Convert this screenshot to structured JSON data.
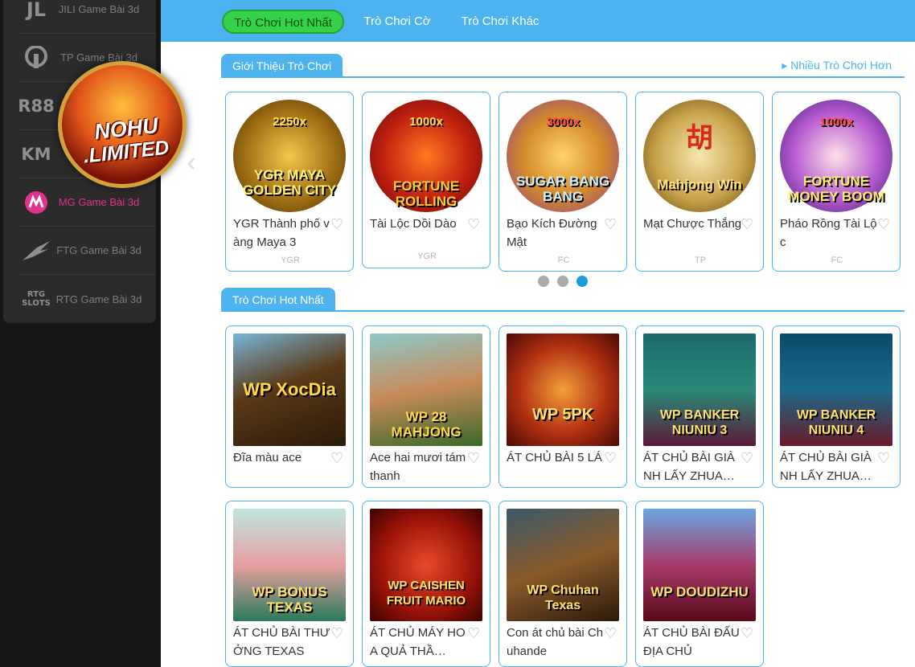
{
  "sidebar": {
    "providers": [
      {
        "logo": "JL",
        "label": "JILI Game Bài 3d"
      },
      {
        "logo": "TP",
        "label": "TP Game Bài 3d"
      },
      {
        "logo": "R88",
        "label": ""
      },
      {
        "logo": "KM",
        "label": ""
      },
      {
        "logo": "M",
        "label": "MG Game Bài 3d"
      },
      {
        "logo": "FTG",
        "label": "FTG Game Bài 3d"
      },
      {
        "logo": "RTG SLOTS",
        "label": "RTG Game Bài 3d"
      }
    ]
  },
  "badge": {
    "line1": "NOHU",
    "line2": ".LIMITED"
  },
  "carousel_prev": "‹",
  "tabs": [
    {
      "label": "Trò Chơi Hot Nhất",
      "active": true
    },
    {
      "label": "Trò Chơi Cờ",
      "active": false
    },
    {
      "label": "Trò Chơi Khác",
      "active": false
    }
  ],
  "featured": {
    "title": "Giới Thiệu Trò Chơi",
    "more": "▸ Nhiều Trò Chơi Hơn",
    "games": [
      {
        "art": "YGR MAYA GOLDEN CITY",
        "badge": "2250x",
        "title": "YGR Thành phố vàng Maya 3",
        "provider": "YGR"
      },
      {
        "art": "FORTUNE ROLLING",
        "badge": "1000x",
        "title": "Tài Lộc Dồi Dào",
        "provider": "YGR"
      },
      {
        "art": "SUGAR BANG BANG",
        "badge": "3000x",
        "title": "Bạo Kích Đường Mật",
        "provider": "FC"
      },
      {
        "art": "Mahjong Win",
        "badge": "胡",
        "title": "Mạt Chược Thắng",
        "provider": "TP"
      },
      {
        "art": "FORTUNE MONEY BOOM",
        "badge": "1000x",
        "title": "Pháo Rồng Tài Lộc",
        "provider": "FC"
      }
    ],
    "dots": [
      false,
      false,
      true
    ]
  },
  "hot": {
    "title": "Trò Chơi Hot Nhất",
    "games": [
      {
        "art": "WP XocDia",
        "title": "Đĩa màu ace"
      },
      {
        "art": "WP 28 MAHJONG",
        "title": "Ace hai mươi tám thanh"
      },
      {
        "art": "WP 5PK",
        "title": "ÁT CHỦ BÀI 5 LÁ"
      },
      {
        "art": "WP BANKER NIUNIU 3",
        "title": "ÁT CHỦ BÀI GIÀNH LẤY ZHUA…"
      },
      {
        "art": "WP BANKER NIUNIU 4",
        "title": "ÁT CHỦ BÀI GIÀNH LẤY ZHUA…"
      },
      {
        "art": "WP BONUS TEXAS",
        "title": "ÁT CHỦ BÀI THƯỞNG TEXAS"
      },
      {
        "art": "WP CAISHEN FRUIT MARIO",
        "title": "ÁT CHỦ MÁY HOA QUẢ THẦ…"
      },
      {
        "art": "WP Chuhan Texas",
        "title": "Con át chủ bài Chuhande"
      },
      {
        "art": "WP DOUDIZHU",
        "title": "ÁT CHỦ BÀI ĐẤU ĐỊA CHỦ"
      }
    ]
  },
  "colors": {
    "accent": "#4cb3ee",
    "active_tab": "#36d14a",
    "sidebar_bg": "#161616",
    "panel_bg": "#2b2b2b"
  }
}
